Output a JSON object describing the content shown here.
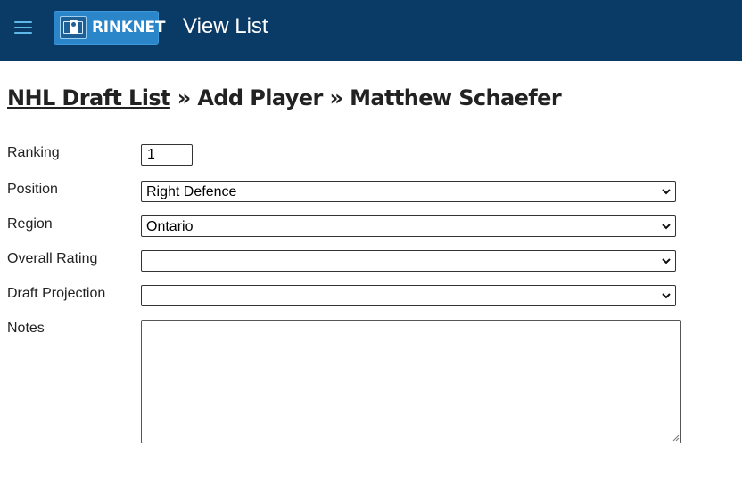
{
  "header": {
    "logo_text": "RINKNET",
    "title": "View List",
    "bg_color": "#0a3a66"
  },
  "breadcrumb": {
    "link": "NHL Draft List",
    "separator": "»",
    "step": "Add Player",
    "player": "Matthew Schaefer"
  },
  "form": {
    "ranking": {
      "label": "Ranking",
      "value": "1"
    },
    "position": {
      "label": "Position",
      "value": "Right Defence"
    },
    "region": {
      "label": "Region",
      "value": "Ontario"
    },
    "overall_rating": {
      "label": "Overall Rating",
      "value": ""
    },
    "draft_projection": {
      "label": "Draft Projection",
      "value": ""
    },
    "notes": {
      "label": "Notes",
      "value": ""
    }
  },
  "icons": {
    "menu": "hamburger-icon",
    "logo": "rinknet-logo-icon",
    "dropdown": "chevron-down-icon",
    "resize": "resize-grip-icon"
  }
}
